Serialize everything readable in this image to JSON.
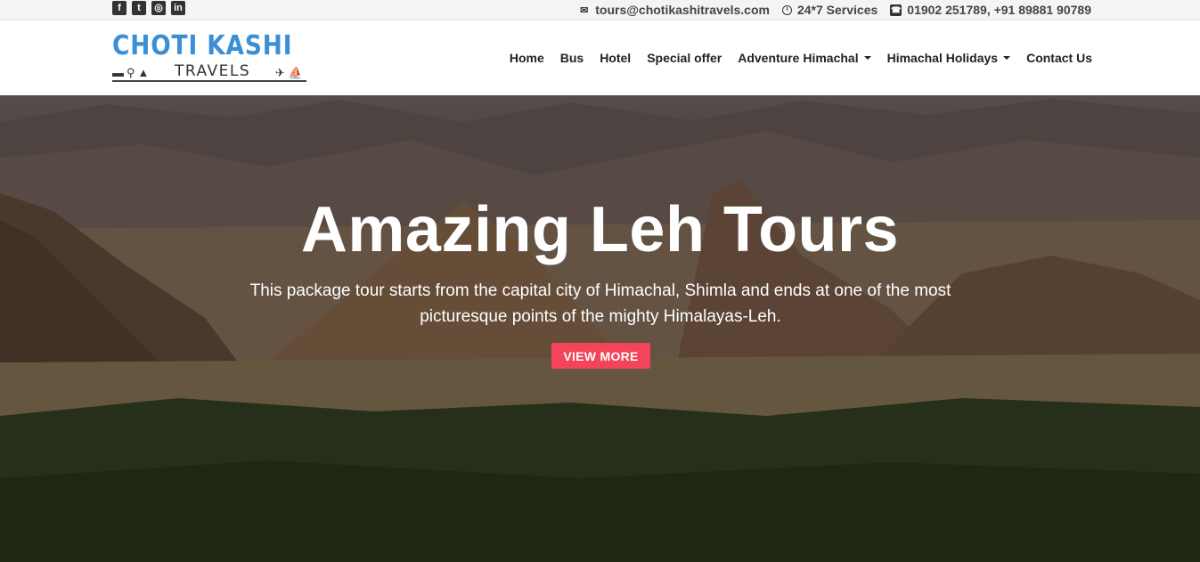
{
  "topbar": {
    "social": [
      {
        "icon": "facebook-icon",
        "glyph": "f"
      },
      {
        "icon": "twitter-icon",
        "glyph": "t"
      },
      {
        "icon": "instagram-icon",
        "glyph": "◎"
      },
      {
        "icon": "linkedin-icon",
        "glyph": "in"
      }
    ],
    "email": "tours@chotikashitravels.com",
    "services": "24*7 Services",
    "phone": "01902 251789, +91 89881 90789"
  },
  "brand": {
    "name_top": "CHOTI KASHI",
    "name_bottom": "TRAVELS",
    "color_primary": "#3a8fd6"
  },
  "nav": {
    "items": [
      {
        "label": "Home",
        "dropdown": false
      },
      {
        "label": "Bus",
        "dropdown": false
      },
      {
        "label": "Hotel",
        "dropdown": false
      },
      {
        "label": "Special offer",
        "dropdown": false
      },
      {
        "label": "Adventure Himachal",
        "dropdown": true
      },
      {
        "label": "Himachal Holidays",
        "dropdown": true
      },
      {
        "label": "Contact Us",
        "dropdown": false
      }
    ]
  },
  "hero": {
    "title": "Amazing Leh Tours",
    "description": "This package tour starts from the capital city of Himachal, Shimla and ends at one of the most picturesque points of the mighty Himalayas-Leh.",
    "button_label": "VIEW MORE",
    "button_color": "#f4445a"
  }
}
